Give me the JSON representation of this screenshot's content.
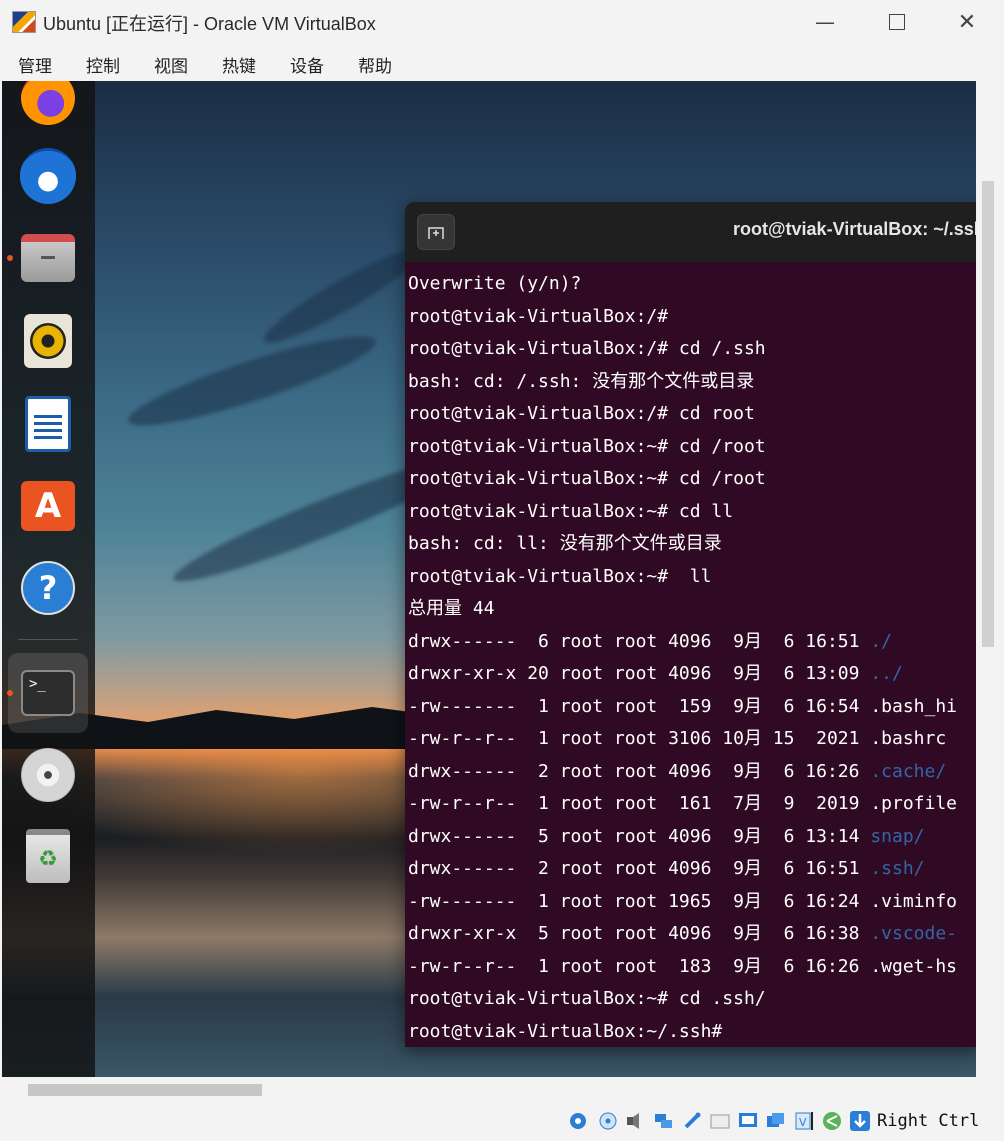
{
  "window": {
    "title": "Ubuntu [正在运行] - Oracle VM VirtualBox",
    "minimize": "—",
    "close": "✕"
  },
  "menu": [
    "管理",
    "控制",
    "视图",
    "热键",
    "设备",
    "帮助"
  ],
  "dock": {
    "apps": [
      {
        "name": "firefox-icon",
        "running": false
      },
      {
        "name": "thunderbird-icon",
        "running": false
      },
      {
        "name": "files-icon",
        "running": true
      },
      {
        "name": "rhythmbox-icon",
        "running": false
      },
      {
        "name": "libreoffice-writer-icon",
        "running": false
      },
      {
        "name": "ubuntu-software-icon",
        "running": false
      },
      {
        "name": "help-icon",
        "running": false
      },
      {
        "name": "terminal-icon",
        "running": true
      },
      {
        "name": "cd-drive-icon",
        "running": false
      },
      {
        "name": "trash-icon",
        "running": false
      }
    ],
    "terminal_glyph": ">_",
    "help_glyph": "?",
    "software_glyph": "A",
    "trash_glyph": "♻"
  },
  "terminal": {
    "title": "root@tviak-VirtualBox: ~/.ssh",
    "lines": [
      "Overwrite (y/n)?",
      "root@tviak-VirtualBox:/#",
      "root@tviak-VirtualBox:/# cd /.ssh",
      "bash: cd: /.ssh: 没有那个文件或目录",
      "root@tviak-VirtualBox:/# cd root",
      "root@tviak-VirtualBox:~# cd /root",
      "root@tviak-VirtualBox:~# cd /root",
      "root@tviak-VirtualBox:~# cd ll",
      "bash: cd: ll: 没有那个文件或目录",
      "root@tviak-VirtualBox:~#  ll",
      "总用量 44",
      {
        "prefix": "drwx------  6 root root 4096  9月  6 16:51 ",
        "name": "./",
        "dir": true
      },
      {
        "prefix": "drwxr-xr-x 20 root root 4096  9月  6 13:09 ",
        "name": "../",
        "dir": true
      },
      {
        "prefix": "-rw-------  1 root root  159  9月  6 16:54 ",
        "name": ".bash_hi",
        "dir": false
      },
      {
        "prefix": "-rw-r--r--  1 root root 3106 10月 15  2021 ",
        "name": ".bashrc",
        "dir": false
      },
      {
        "prefix": "drwx------  2 root root 4096  9月  6 16:26 ",
        "name": ".cache/",
        "dir": true
      },
      {
        "prefix": "-rw-r--r--  1 root root  161  7月  9  2019 ",
        "name": ".profile",
        "dir": false
      },
      {
        "prefix": "drwx------  5 root root 4096  9月  6 13:14 ",
        "name": "snap/",
        "dir": true
      },
      {
        "prefix": "drwx------  2 root root 4096  9月  6 16:51 ",
        "name": ".ssh/",
        "dir": true
      },
      {
        "prefix": "-rw-------  1 root root 1965  9月  6 16:24 ",
        "name": ".viminfo",
        "dir": false
      },
      {
        "prefix": "drwxr-xr-x  5 root root 4096  9月  6 16:38 ",
        "name": ".vscode-",
        "dir": true
      },
      {
        "prefix": "-rw-r--r--  1 root root  183  9月  6 16:26 ",
        "name": ".wget-hs",
        "dir": false
      },
      "root@tviak-VirtualBox:~# cd .ssh/",
      "root@tviak-VirtualBox:~/.ssh#"
    ]
  },
  "statusbar": {
    "icons": [
      "hard-disk-icon",
      "optical-drive-icon",
      "audio-icon",
      "network-icon",
      "usb-icon",
      "shared-folders-icon",
      "display-icon",
      "recording-icon",
      "cpu-icon",
      "mouse-integration-icon",
      "keyboard-icon"
    ],
    "host_key": "Right Ctrl"
  }
}
